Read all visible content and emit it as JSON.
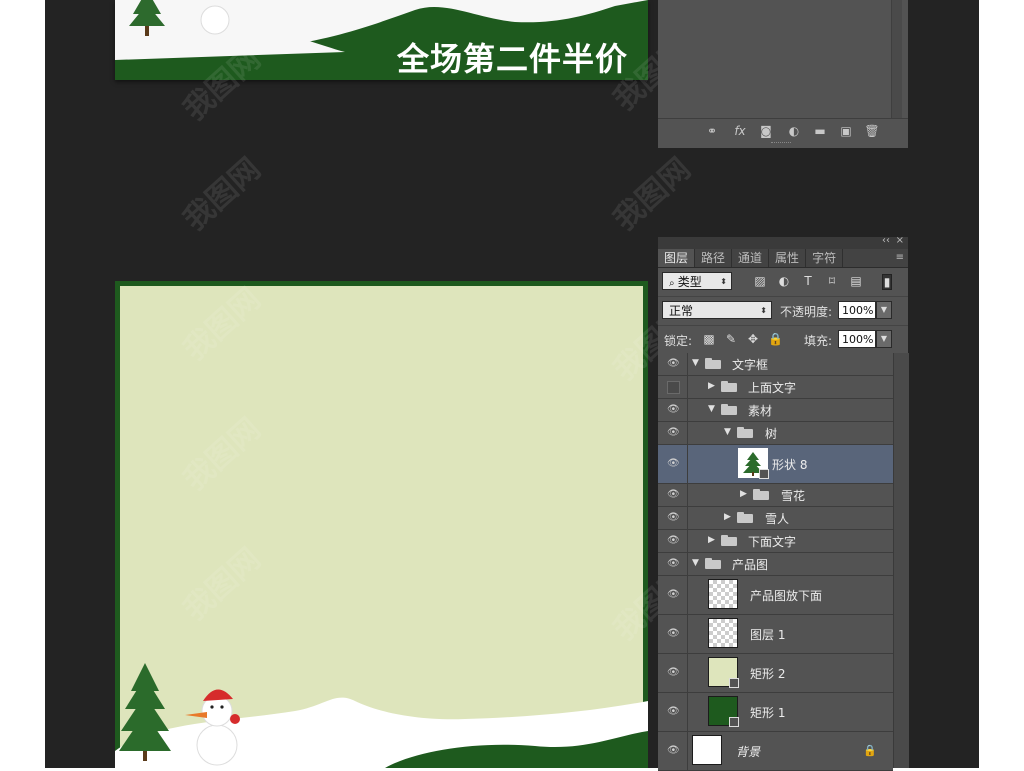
{
  "canvas": {
    "banner_text": "全场第二件半价",
    "watermark": "我图网",
    "colors": {
      "dark_green": "#1e5a1e",
      "light_green": "#dee5bc",
      "workspace": "#232323"
    }
  },
  "top_panel": {
    "footer_icons": [
      "link-icon",
      "fx-icon",
      "mask-icon",
      "adjustment-icon",
      "folder-icon",
      "new-layer-icon",
      "trash-icon"
    ],
    "fx_label": "fx"
  },
  "layers_panel": {
    "header_collapse": "‹‹",
    "header_close": "×",
    "tabs": [
      {
        "label": "图层"
      },
      {
        "label": "路径"
      },
      {
        "label": "通道"
      },
      {
        "label": "属性"
      },
      {
        "label": "字符"
      }
    ],
    "menu_icon": "≡",
    "filter": {
      "label": "类型"
    },
    "blend_mode": "正常",
    "opacity_label": "不透明度:",
    "opacity_value": "100%",
    "lock_label": "锁定:",
    "fill_label": "填充:",
    "fill_value": "100%",
    "layers": [
      {
        "name": "文字框",
        "kind": "group",
        "depth": 0,
        "expanded": true,
        "visible": true
      },
      {
        "name": "上面文字",
        "kind": "group",
        "depth": 1,
        "expanded": false,
        "visible": false
      },
      {
        "name": "素材",
        "kind": "group",
        "depth": 1,
        "expanded": true,
        "visible": true
      },
      {
        "name": "树",
        "kind": "group",
        "depth": 2,
        "expanded": true,
        "visible": true
      },
      {
        "name": "形状 8",
        "kind": "shape",
        "depth": 3,
        "visible": true,
        "selected": true
      },
      {
        "name": "雪花",
        "kind": "group",
        "depth": 3,
        "expanded": false,
        "visible": true
      },
      {
        "name": "雪人",
        "kind": "group",
        "depth": 2,
        "expanded": false,
        "visible": true
      },
      {
        "name": "下面文字",
        "kind": "group",
        "depth": 1,
        "expanded": false,
        "visible": true
      },
      {
        "name": "产品图",
        "kind": "group",
        "depth": 0,
        "expanded": true,
        "visible": true
      },
      {
        "name": "产品图放下面",
        "kind": "pixel",
        "depth": 1,
        "visible": true
      },
      {
        "name": "图层 1",
        "kind": "pixel",
        "depth": 1,
        "visible": true
      },
      {
        "name": "矩形 2",
        "kind": "rect-light",
        "depth": 1,
        "visible": true
      },
      {
        "name": "矩形 1",
        "kind": "rect-dark",
        "depth": 1,
        "visible": true
      },
      {
        "name": "背景",
        "kind": "background",
        "depth": 0,
        "visible": true,
        "locked": true
      }
    ]
  }
}
